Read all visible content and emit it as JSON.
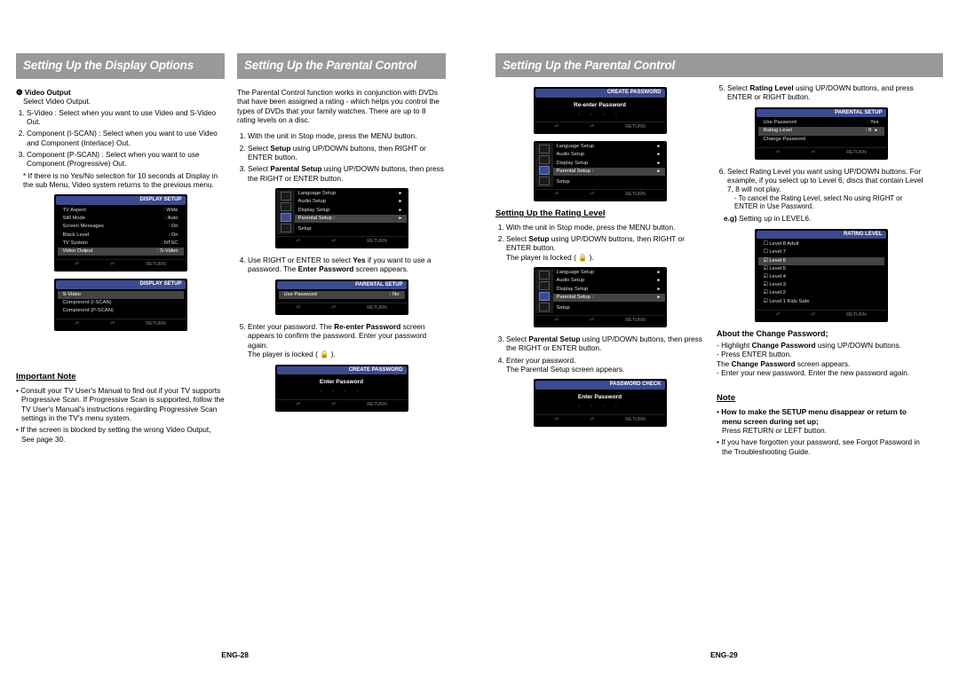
{
  "pageLeftNum": "ENG-28",
  "pageRightNum": "ENG-29",
  "headers": {
    "displayOptions": "Setting Up the Display Options",
    "parentalControl": "Setting Up the Parental Control"
  },
  "col1": {
    "videoOutputNum": "❻",
    "videoOutputTitle": "Video Output",
    "videoOutputDesc": "Select Video Output.",
    "vo1": "S-Video : Select when you want to use Video and S-Video Out.",
    "vo2": "Component (I-SCAN) : Select when you want to use Video and Component (Interlace) Out.",
    "vo3": "Component (P-SCAN) : Select when you want to use Component (Progressive) Out.",
    "voStar": "* If there is no Yes/No selection for 10 seconds at Display in the sub Menu, Video system returns to the previous menu.",
    "importantNote": "Important Note",
    "note1": "Consult your TV User's Manual to find out if your TV supports Progressive Scan. If Progressive Scan is supported, follow the TV User's Manual's instructions regarding Progressive Scan settings in the TV's menu system.",
    "note2": "If the screen is blocked by setting the wrong Video Output, See page 30.",
    "osd1": {
      "title": "DISPLAY SETUP",
      "rows": [
        {
          "k": "TV Aspect",
          "v": ": Wide"
        },
        {
          "k": "Still Mode",
          "v": ": Auto"
        },
        {
          "k": "Screen Messages",
          "v": ": On"
        },
        {
          "k": "Black Level",
          "v": ": On"
        },
        {
          "k": "TV System",
          "v": ": NTSC"
        },
        {
          "k": "Video Output",
          "v": ": S-Video",
          "hl": true
        }
      ]
    },
    "osd2": {
      "title": "DISPLAY SETUP",
      "rows": [
        {
          "k": "S-Video",
          "v": ""
        },
        {
          "k": "Component (I-SCAN)",
          "v": ""
        },
        {
          "k": "Component (P-SCAN)",
          "v": ""
        }
      ]
    }
  },
  "col2": {
    "intro": "The Parental Control function works in conjunction with DVDs that have been assigned a rating - which helps you control the types of DVDs that your family watches. There are up to 8 rating levels on a disc.",
    "s1": "With the unit in Stop mode, press the MENU button.",
    "s2a": "Select ",
    "s2b": "Setup",
    "s2c": " using UP/DOWN buttons, then RIGHT or ENTER button.",
    "s3a": "Select ",
    "s3b": "Parental Setup",
    "s3c": " using UP/DOWN buttons, then press the RIGHT or ENTER button.",
    "s4a": "Use RIGHT or ENTER to select ",
    "s4b": "Yes",
    "s4c": " if you want to use a password. The ",
    "s4d": "Enter Password",
    "s4e": " screen appears.",
    "s5a": "Enter your password. The ",
    "s5b": "Re-enter Password",
    "s5c": " screen appears to confirm the password. Enter your password again.",
    "s5d": "The player is locked ( 🔒 ).",
    "osd_setup": {
      "rows": [
        {
          "k": "Language Setup",
          "v": "►"
        },
        {
          "k": "Audio Setup",
          "v": "►"
        },
        {
          "k": "Display Setup",
          "v": "►"
        },
        {
          "k": "Parental Setup :",
          "v": "►",
          "hl": true
        }
      ],
      "label": "Setup"
    },
    "osd_parental": {
      "title": "PARENTAL SETUP",
      "rows": [
        {
          "k": "Use Password",
          "v": ": No",
          "hl": true
        }
      ]
    },
    "osd_enterpw": {
      "title": "CREATE PASSWORD",
      "center": "Enter Password"
    }
  },
  "col3": {
    "osd_reenter": {
      "title": "CREATE PASSWORD",
      "center": "Re-enter Password"
    },
    "ratingHeading": "Setting Up the Rating Level",
    "r1": "With the unit in Stop mode, press the MENU button.",
    "r2a": "Select ",
    "r2b": "Setup",
    "r2c": " using UP/DOWN buttons, then RIGHT or ENTER button.",
    "r2d": "The player is locked ( 🔒 ).",
    "r3a": "Select ",
    "r3b": "Parental Setup",
    "r3c": " using UP/DOWN buttons, then press the RIGHT or ENTER button.",
    "r4a": "Enter your password.",
    "r4b": "The Parental Setup screen appears.",
    "osd_pwcheck": {
      "title": "PASSWORD CHECK",
      "center": "Enter Password"
    }
  },
  "col4": {
    "r5a": "Select ",
    "r5b": "Rating Level",
    "r5c": " using UP/DOWN buttons, and press ENTER or RIGHT button.",
    "osd_ps": {
      "title": "PARENTAL SETUP",
      "rows": [
        {
          "k": "Use Password",
          "v": ": Yes"
        },
        {
          "k": "Rating Level",
          "v": ": 8",
          "hl": true
        },
        {
          "k": "Change Password",
          "v": ""
        }
      ]
    },
    "r6a": "Select Rating Level you want using UP/DOWN buttons. For example, if you select up to Level 6, discs that contain Level 7, 8 will not play.",
    "r6b": "- To cancel the Rating Level, select No using RIGHT or ENTER in Use Password.",
    "eg_label": "e.g)",
    "eg": " Setting up in LEVEL6.",
    "osd_rl": {
      "title": "RATING LEVEL",
      "rows": [
        {
          "k": "Level 8 Adult",
          "v": ""
        },
        {
          "k": "Level 7",
          "v": ""
        },
        {
          "k": "Level 6",
          "v": "",
          "hl": true
        },
        {
          "k": "Level 5",
          "v": ""
        },
        {
          "k": "Level 4",
          "v": ""
        },
        {
          "k": "Level 3",
          "v": ""
        },
        {
          "k": "Level 2",
          "v": ""
        },
        {
          "k": "Level 1 Kids Safe",
          "v": ""
        }
      ]
    },
    "changePwHead": "About the Change Password;",
    "cp1a": "- Highlight ",
    "cp1b": "Change Password",
    "cp1c": " using UP/DOWN buttons.",
    "cp2": "- Press ENTER button.",
    "cp3a": "  The ",
    "cp3b": "Change Password",
    "cp3c": " screen appears.",
    "cp4": "- Enter your new password. Enter the new password again.",
    "noteHead": "Note",
    "n1a": "How to make the SETUP menu disappear or return to menu screen during set up;",
    "n1b": "Press RETURN or LEFT button.",
    "n2": "If you have forgotten your password, see Forgot Password in the Troubleshooting Guide."
  },
  "footer": {
    "btns": [
      "⏎",
      "⏎",
      "RETURN"
    ]
  }
}
